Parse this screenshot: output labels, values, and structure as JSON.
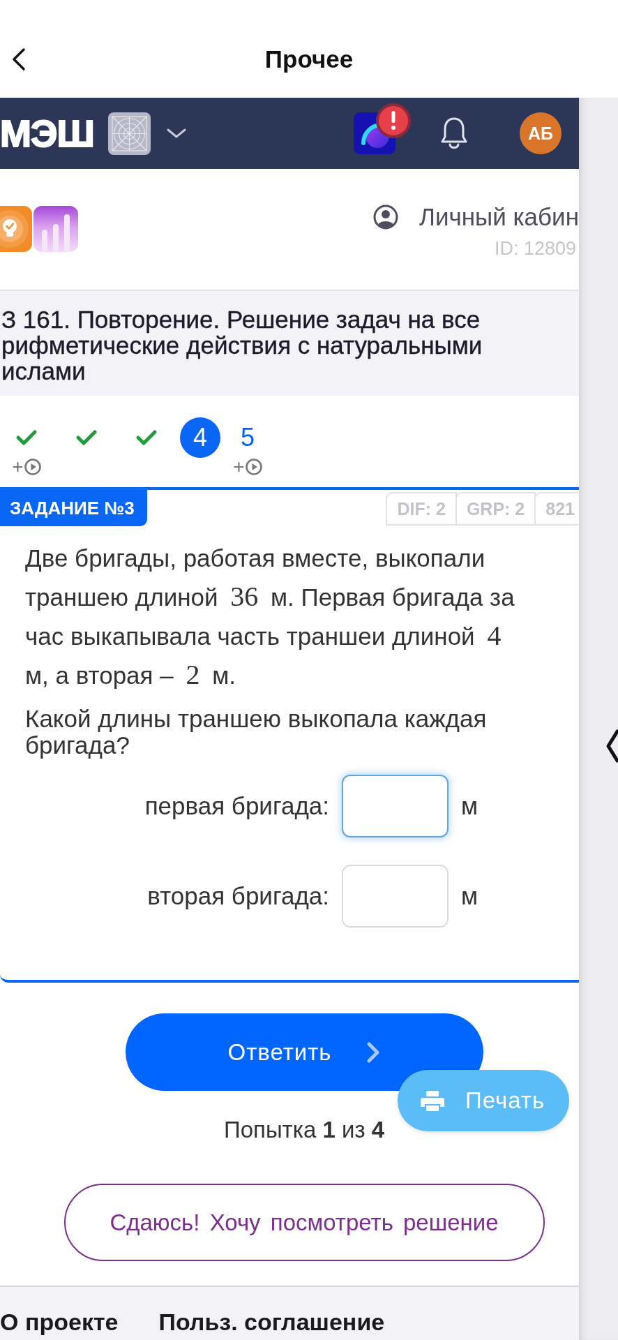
{
  "nav_bar": {
    "title": "Прочее"
  },
  "header": {
    "brand": "МЭШ",
    "alert": true,
    "avatar_initials": "АБ"
  },
  "profile": {
    "link": "Личный кабин",
    "id": "ID: 12809"
  },
  "lesson": {
    "title_lines": [
      "З 161. Повторение. Решение задач на все",
      "рифметические действия с натуральными",
      "ислами"
    ]
  },
  "progress": [
    {
      "kind": "done",
      "selected": false,
      "bonus": "+"
    },
    {
      "kind": "done",
      "selected": false
    },
    {
      "kind": "done",
      "selected": false
    },
    {
      "kind": "number",
      "label": "4",
      "selected": true
    },
    {
      "kind": "number",
      "label": "5",
      "selected": false,
      "bonus": "+"
    }
  ],
  "task": {
    "badge": "ЗАДАНИЕ №3",
    "tags": [
      "DIF: 2",
      "GRP: 2",
      "821"
    ],
    "statement": [
      {
        "kind": "text",
        "text": "Две бригады, работая вместе, выкопали траншею длиной "
      },
      {
        "kind": "math",
        "text": "36"
      },
      {
        "kind": "text",
        "text": " м. Первая бригада за час выкапывала часть траншеи длиной "
      },
      {
        "kind": "math",
        "text": "4"
      },
      {
        "kind": "text",
        "text": " м, а вторая – "
      },
      {
        "kind": "math",
        "text": "2"
      },
      {
        "kind": "text",
        "text": " м."
      }
    ],
    "question": "Какой длины траншею выкопала каждая бригада?",
    "answers": [
      {
        "label": "первая бригада:",
        "unit": "м",
        "focused": true
      },
      {
        "label": "вторая бригада:",
        "unit": "м",
        "focused": false
      }
    ]
  },
  "actions": {
    "submit": "Ответить",
    "print": "Печать",
    "attempt": "Попытка **1** из **4**",
    "give_up": "Сдаюсь! Хочу посмотреть решение"
  },
  "footer": {
    "links": [
      "О проекте",
      "Польз. соглашение"
    ]
  }
}
